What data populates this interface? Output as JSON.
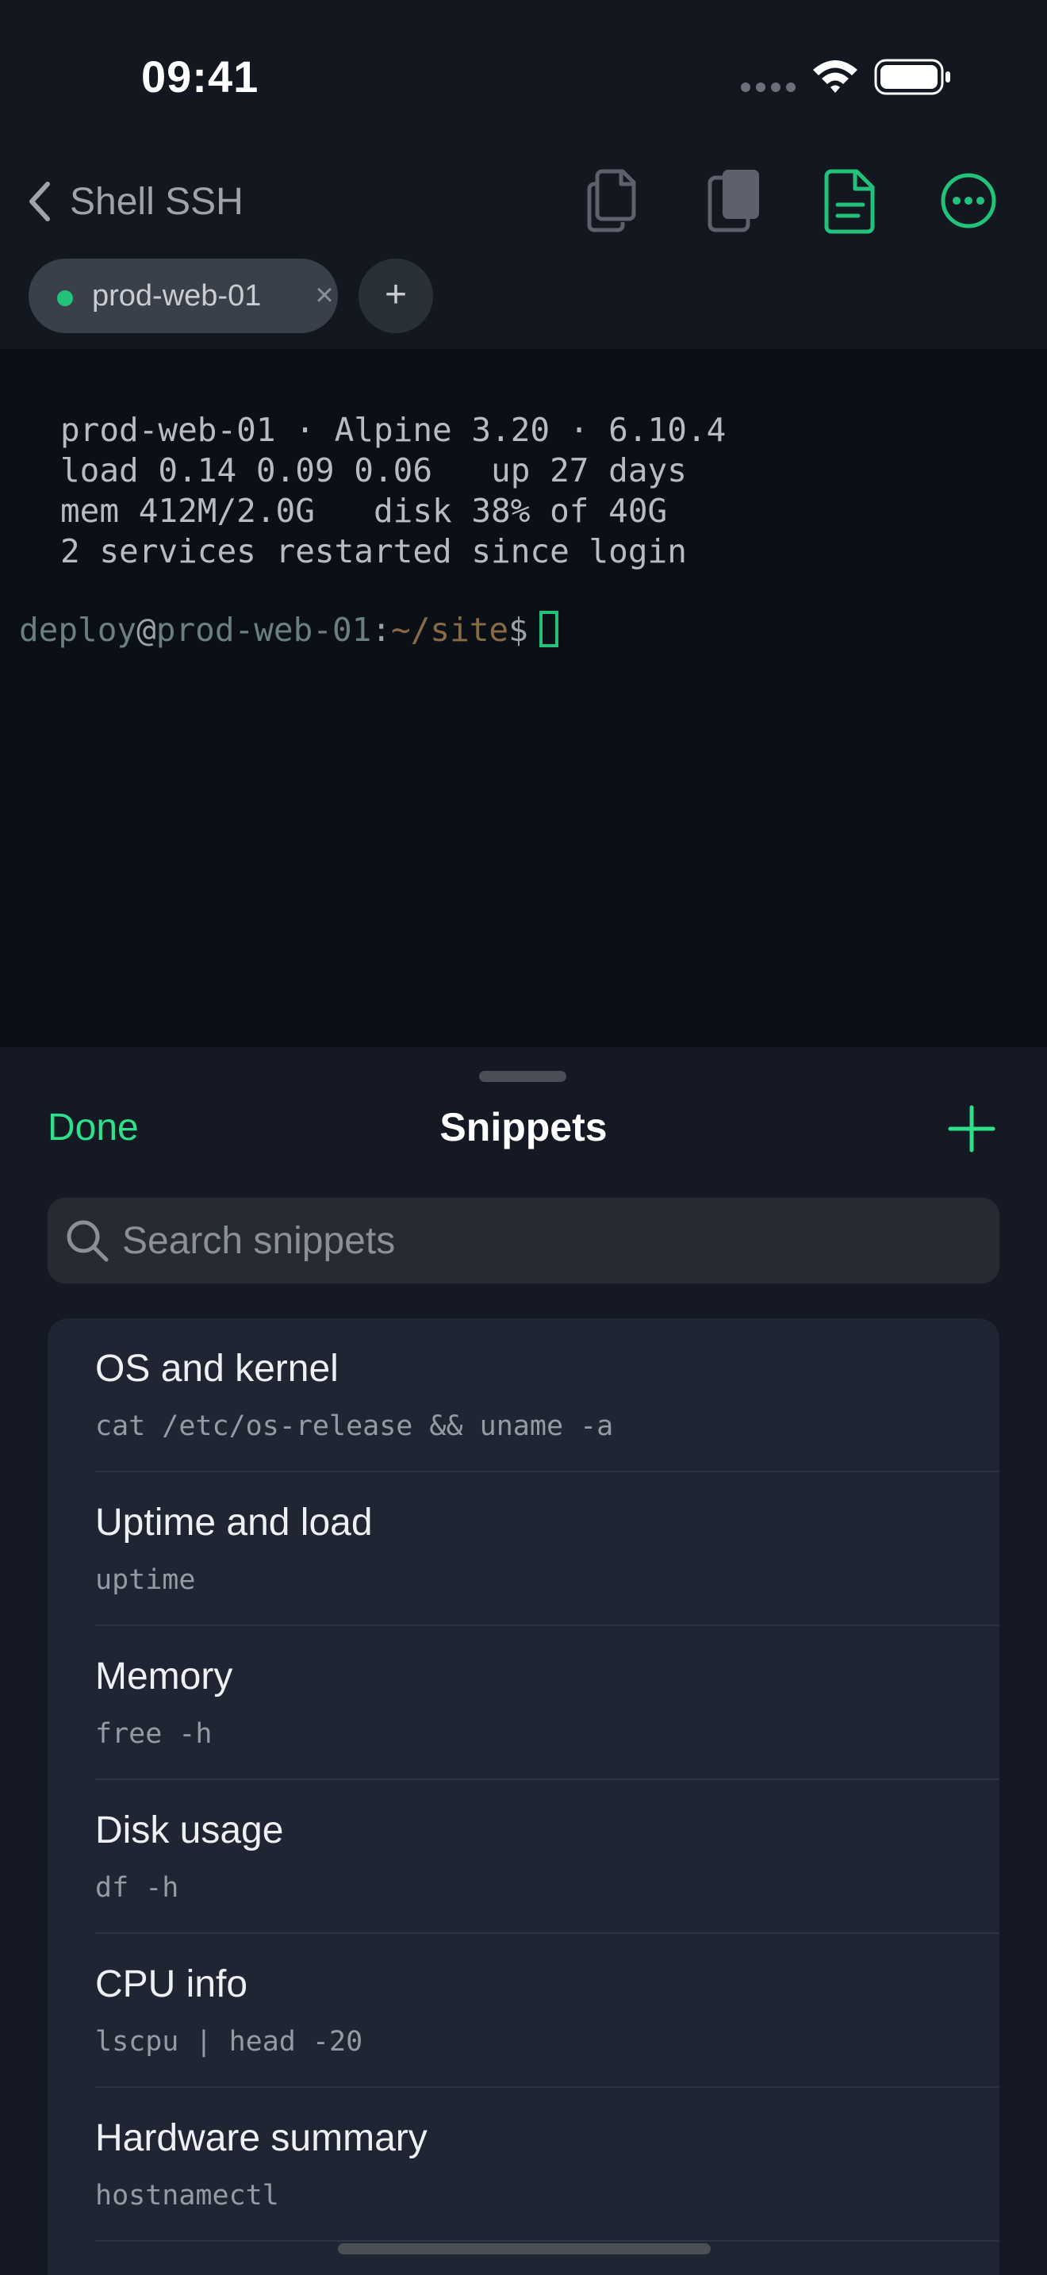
{
  "status_bar": {
    "time": "09:41"
  },
  "nav": {
    "back_label": "Shell SSH",
    "icons": [
      "copy-icon",
      "paste-icon",
      "document-icon",
      "more-icon"
    ]
  },
  "tabs": [
    {
      "label": "prod-web-01",
      "active": true,
      "status": "connected"
    }
  ],
  "terminal": {
    "motd": [
      "prod-web-01 · Alpine 3.20 · 6.10.4",
      "load 0.14 0.09 0.06   up 27 days",
      "mem 412M/2.0G   disk 38% of 40G",
      "2 services restarted since login"
    ],
    "prompt": {
      "user": "deploy",
      "at": "@",
      "host": "prod-web-01",
      "colon": ":",
      "path": "~/site",
      "symbol": "$"
    }
  },
  "sheet": {
    "done_label": "Done",
    "title": "Snippets",
    "search_placeholder": "Search snippets",
    "snippets": [
      {
        "title": "OS and kernel",
        "command": "cat /etc/os-release && uname -a"
      },
      {
        "title": "Uptime and load",
        "command": "uptime"
      },
      {
        "title": "Memory",
        "command": "free -h"
      },
      {
        "title": "Disk usage",
        "command": "df -h"
      },
      {
        "title": "CPU info",
        "command": "lscpu | head -20"
      },
      {
        "title": "Hardware summary",
        "command": "hostnamectl"
      }
    ]
  },
  "colors": {
    "accent": "#2ee08a",
    "connected_dot": "#23c27a",
    "background": "#0b0f16",
    "sheet": "#141923",
    "card": "#1f2533"
  }
}
